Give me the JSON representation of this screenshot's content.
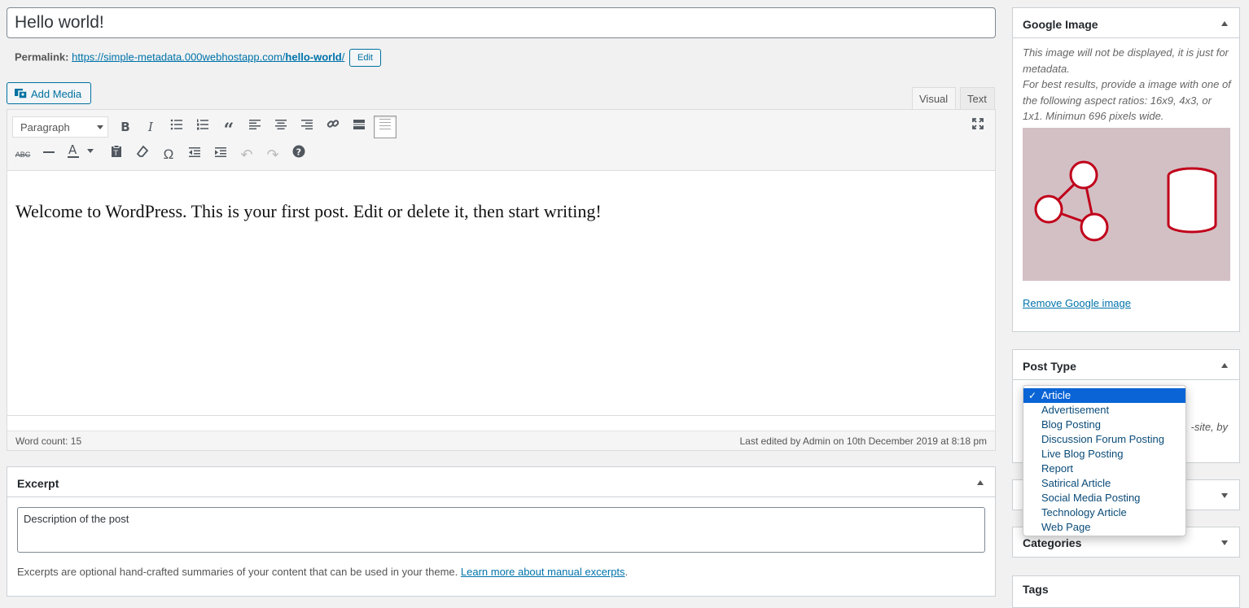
{
  "post": {
    "title": "Hello world!",
    "permalink_label": "Permalink:",
    "permalink_base": "https://simple-metadata.000webhostapp.com/",
    "permalink_slug": "hello-world",
    "permalink_trail": "/",
    "edit_label": "Edit"
  },
  "editor": {
    "add_media_label": "Add Media",
    "tab_visual": "Visual",
    "tab_text": "Text",
    "format_value": "Paragraph",
    "content": "Welcome to WordPress. This is your first post. Edit or delete it, then start writing!",
    "word_count": "Word count: 15",
    "last_edited": "Last edited by Admin on 10th December 2019 at 8:18 pm",
    "toolbar_icons": [
      "bold-icon",
      "italic-icon",
      "bullet-list-icon",
      "numbered-list-icon",
      "blockquote-icon",
      "align-left-icon",
      "align-center-icon",
      "align-right-icon",
      "link-icon",
      "read-more-icon",
      "toolbar-toggle-icon",
      "fullscreen-icon",
      "strikethrough-icon",
      "horizontal-line-icon",
      "text-color-icon",
      "paste-text-icon",
      "clear-formatting-icon",
      "special-character-icon",
      "outdent-icon",
      "indent-icon",
      "undo-icon",
      "redo-icon",
      "help-icon"
    ]
  },
  "excerpt": {
    "title": "Excerpt",
    "value": "Description of the post",
    "help": "Excerpts are optional hand-crafted summaries of your content that can be used in your theme.",
    "help_link": "Learn more about manual excerpts",
    "help_end": "."
  },
  "sidebar": {
    "google_image": {
      "title": "Google Image",
      "desc1": "This image will not be displayed, it is just for metadata.",
      "desc2": "For best results, provide a image with one of the following aspect ratios: 16x9, 4x3, or 1x1. Minimun 696 pixels wide.",
      "remove_label": "Remove Google image"
    },
    "post_type": {
      "title": "Post Type",
      "hint": "-site, by",
      "options": [
        "Article",
        "Advertisement",
        "Blog Posting",
        "Discussion Forum Posting",
        "Live Blog Posting",
        "Report",
        "Satirical Article",
        "Social Media Posting",
        "Technology Article",
        "Web Page"
      ],
      "selected": "Article"
    },
    "categories_title": "Categories",
    "tags_title": "Tags"
  },
  "colors": {
    "accent": "#0073aa",
    "selection": "#0a64d6",
    "image_bg": "#d3c0c4",
    "icon_red": "#c0001a"
  }
}
